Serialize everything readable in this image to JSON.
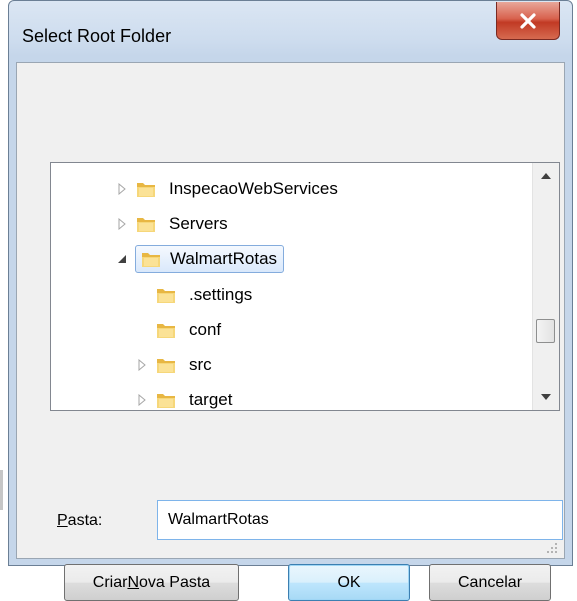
{
  "window": {
    "title": "Select Root Folder",
    "close_symbol": "close-icon"
  },
  "tree": {
    "items": [
      {
        "label": "InspecaoWebServices",
        "expander": "collapsed",
        "level": 1
      },
      {
        "label": "Servers",
        "expander": "collapsed",
        "level": 1
      },
      {
        "label": "WalmartRotas",
        "expander": "expanded",
        "level": 1,
        "selected": true
      },
      {
        "label": ".settings",
        "expander": "none",
        "level": 2
      },
      {
        "label": "conf",
        "expander": "none",
        "level": 2
      },
      {
        "label": "src",
        "expander": "collapsed",
        "level": 2
      },
      {
        "label": "target",
        "expander": "collapsed",
        "level": 2
      }
    ],
    "scroll_position": 0.7
  },
  "folder_field": {
    "label_prefix": "P",
    "label_rest": "asta:",
    "value": "WalmartRotas"
  },
  "buttons": {
    "new_folder_pre": "Criar ",
    "new_folder_key": "N",
    "new_folder_post": "ova Pasta",
    "ok": "OK",
    "cancel": "Cancelar"
  },
  "colors": {
    "close_red": "#c13a24",
    "selection_border": "#7da2ce",
    "input_border": "#7eb4ea"
  }
}
